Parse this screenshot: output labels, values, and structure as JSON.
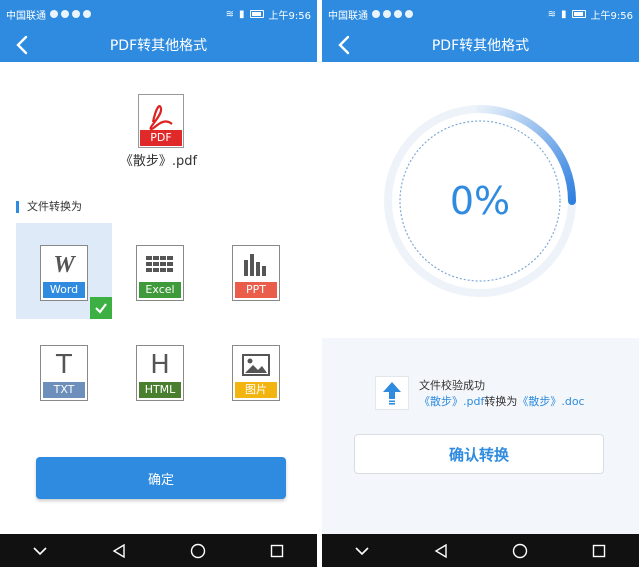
{
  "status_bar": {
    "carrier": "中国联通",
    "time": "上午9:56"
  },
  "left_screen": {
    "title": "PDF转其他格式",
    "source_file": {
      "badge": "PDF",
      "name": "《散步》.pdf",
      "badge_color": "#e02a2a"
    },
    "section_label": "文件转换为",
    "options": [
      {
        "label": "Word",
        "glyph": "W",
        "color": "#2e8be0",
        "selected": true
      },
      {
        "label": "Excel",
        "glyph": "grid",
        "color": "#3f9a3c",
        "selected": false
      },
      {
        "label": "PPT",
        "glyph": "bars",
        "color": "#ea5d4b",
        "selected": false
      },
      {
        "label": "TXT",
        "glyph": "T",
        "color": "#6c8fbb",
        "selected": false
      },
      {
        "label": "HTML",
        "glyph": "H",
        "color": "#4a7f2f",
        "selected": false
      },
      {
        "label": "图片",
        "glyph": "image",
        "color": "#f2b40f",
        "selected": false
      }
    ],
    "confirm_label": "确定"
  },
  "right_screen": {
    "title": "PDF转其他格式",
    "progress": 0,
    "progress_label": "0%",
    "verify_title": "文件校验成功",
    "verify_source": "《散步》.pdf",
    "verify_mid": "转换为",
    "verify_target": "《散步》.doc",
    "action_label": "确认转换"
  },
  "colors": {
    "accent": "#2e8be0",
    "check": "#3cb043",
    "selected_bg": "#dfeaf8"
  }
}
